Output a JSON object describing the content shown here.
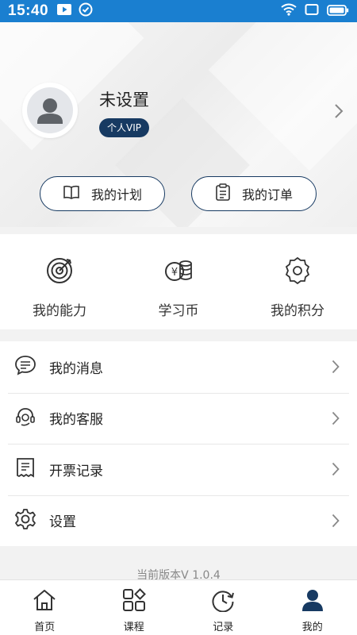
{
  "status_bar": {
    "time": "15:40"
  },
  "profile": {
    "name": "未设置",
    "vip_label": "个人VIP"
  },
  "quick_actions": {
    "plan_label": "我的计划",
    "orders_label": "我的订单"
  },
  "stats": [
    {
      "label": "我的能力",
      "icon": "target-icon"
    },
    {
      "label": "学习币",
      "icon": "coins-icon"
    },
    {
      "label": "我的积分",
      "icon": "badge-icon"
    }
  ],
  "menu": [
    {
      "label": "我的消息",
      "icon": "message-icon"
    },
    {
      "label": "我的客服",
      "icon": "headset-icon"
    },
    {
      "label": "开票记录",
      "icon": "invoice-icon"
    },
    {
      "label": "设置",
      "icon": "gear-icon"
    }
  ],
  "version": "当前版本V 1.0.4",
  "tabs": [
    {
      "label": "首页",
      "icon": "home-icon",
      "active": false
    },
    {
      "label": "课程",
      "icon": "grid-icon",
      "active": false
    },
    {
      "label": "记录",
      "icon": "clock-icon",
      "active": false
    },
    {
      "label": "我的",
      "icon": "person-icon",
      "active": true
    }
  ],
  "colors": {
    "status_bar": "#1a7fd0",
    "accent": "#173a62",
    "background": "#f2f2f2"
  }
}
